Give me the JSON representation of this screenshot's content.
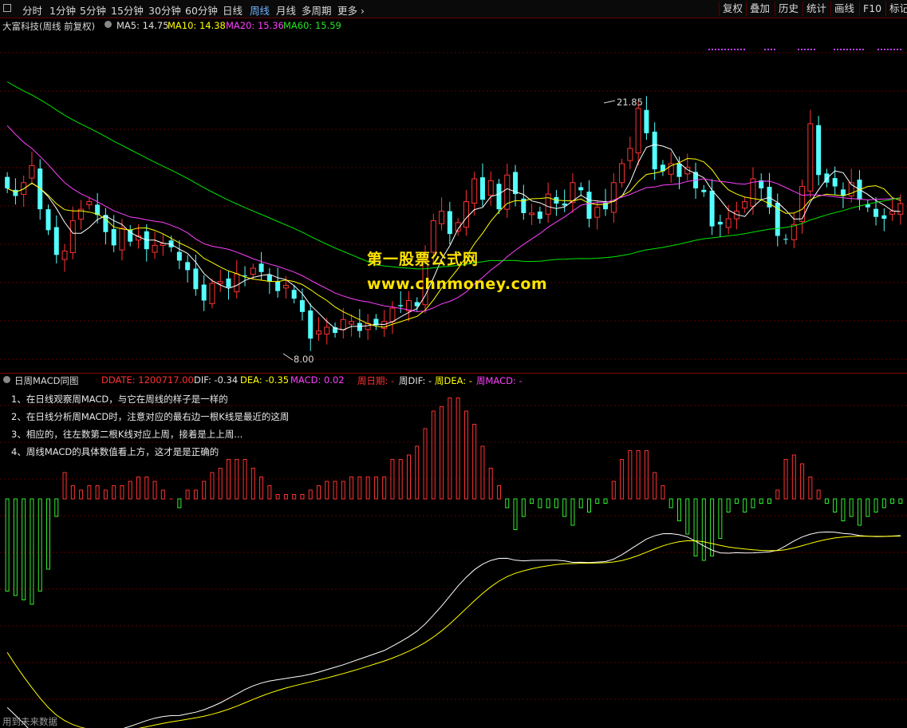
{
  "topbar": {
    "periods": [
      "分时",
      "1分钟",
      "5分钟",
      "15分钟",
      "30分钟",
      "60分钟",
      "日线",
      "周线",
      "月线",
      "多周期",
      "更多"
    ],
    "active_period": "周线",
    "right_buttons": [
      "复权",
      "叠加",
      "历史",
      "统计",
      "画线",
      "F10",
      "标记"
    ]
  },
  "main": {
    "title": "大富科技(周线 前复权)",
    "ma5": "MA5: 14.75",
    "ma10": "MA10: 14.38",
    "ma20": "MA20: 15.36",
    "ma60": "MA60: 15.59",
    "high_label": "21.85",
    "low_label": "8.00"
  },
  "watermark": {
    "line1": "第一股票公式网",
    "line2": "www.chnmoney.com"
  },
  "macd": {
    "title": "日周MACD同图",
    "ddate": "DDATE: 1200717.00",
    "dif": "DIF: -0.34",
    "dea": "DEA: -0.35",
    "macd": "MACD: 0.02",
    "week_date": "周日期: -",
    "week_dif": "周DIF: -",
    "week_dea": "周DEA: -",
    "week_macd": "周MACD: -",
    "notes": [
      "1、在日线观察周MACD，与它在周线的样子是一样的",
      "2、在日线分析周MACD时，注意对应的最右边一根K线是最近的这周",
      "3、相应的，往左数第二根K线对应上周，接着是上上周...",
      "4、周线MACD的具体数值看上方，这才是是正确的"
    ]
  },
  "footer": "用到未来数据",
  "colors": {
    "up": "#ff3232",
    "down": "#54ffff",
    "ma5": "#ffffff",
    "ma10": "#ffff00",
    "ma20": "#ff40ff",
    "ma60": "#00e600",
    "macd_pos": "#ff3232",
    "macd_neg": "#33ee33",
    "grid": "#5a0000"
  },
  "chart_data": [
    {
      "type": "candlestick",
      "series": [
        {
          "name": "MA5"
        },
        {
          "name": "MA10"
        },
        {
          "name": "MA20"
        },
        {
          "name": "MA60"
        }
      ],
      "annotations": [
        "21.85",
        "8.00"
      ],
      "close": [
        16.9,
        16.5,
        17.2,
        18.1,
        15.8,
        14.7,
        13.4,
        13.6,
        15.2,
        15.8,
        16.2,
        15.5,
        14.6,
        13.9,
        14.8,
        14.1,
        14.4,
        13.7,
        13.9,
        14.0,
        13.8,
        13.1,
        12.6,
        11.6,
        11.0,
        11.9,
        12.0,
        11.7,
        12.4,
        12.3,
        12.7,
        12.5,
        12.0,
        11.5,
        11.8,
        11.1,
        10.4,
        9.0,
        9.4,
        9.6,
        9.3,
        10.0,
        9.9,
        9.4,
        9.8,
        9.7,
        9.9,
        10.6,
        10.7,
        11.0,
        10.7,
        13.3,
        15.2,
        15.7,
        14.5,
        15.1,
        16.2,
        17.4,
        16.3,
        17.3,
        15.8,
        17.6,
        16.6,
        15.6,
        15.6,
        15.3,
        16.6,
        16.1,
        16.0,
        17.2,
        16.8,
        15.3,
        15.9,
        15.8,
        17.2,
        18.2,
        19.0,
        21.1,
        19.8,
        17.9,
        17.8,
        18.2,
        17.5,
        18.0,
        16.9,
        16.7,
        14.9,
        15.0,
        15.3,
        15.7,
        16.2,
        17.4,
        16.9,
        15.9,
        14.4,
        14.2,
        15.0,
        17.0,
        20.3,
        17.6,
        17.2,
        17.0,
        16.5,
        17.2,
        16.3,
        15.9,
        15.4,
        15.3,
        15.7,
        16.1
      ]
    },
    {
      "type": "bar",
      "series": [
        {
          "name": "MACD",
          "values": [
            -2.1,
            -2.2,
            -2.3,
            -2.4,
            -2.1,
            -1.6,
            -0.4,
            0.6,
            0.3,
            0.2,
            0.3,
            0.3,
            0.2,
            0.3,
            0.3,
            0.4,
            0.5,
            0.5,
            0.4,
            0.2,
            0.0,
            -0.2,
            0.2,
            0.2,
            0.4,
            0.6,
            0.7,
            0.9,
            0.9,
            0.9,
            0.7,
            0.5,
            0.3,
            0.1,
            0.1,
            0.1,
            0.1,
            0.2,
            0.3,
            0.4,
            0.4,
            0.4,
            0.5,
            0.5,
            0.5,
            0.5,
            0.5,
            0.9,
            0.9,
            1.0,
            1.2,
            1.6,
            2.0,
            2.1,
            2.3,
            2.3,
            2.0,
            1.7,
            1.2,
            0.7,
            0.3,
            -0.2,
            -0.7,
            -0.4,
            -0.1,
            -0.2,
            -0.2,
            -0.2,
            -0.4,
            -0.6,
            -0.2,
            -0.3,
            -0.1,
            -0.1,
            0.4,
            0.9,
            1.1,
            1.1,
            1.1,
            0.6,
            0.3,
            -0.2,
            -0.5,
            -0.8,
            -1.3,
            -1.4,
            -1.3,
            -0.9,
            -0.3,
            -0.1,
            -0.3,
            -0.2,
            -0.1,
            -0.1,
            0.2,
            0.9,
            1.0,
            0.8,
            0.5,
            0.2,
            -0.1,
            -0.3,
            -0.5,
            -0.4,
            -0.6,
            -0.4,
            -0.3,
            -0.2,
            -0.1,
            -0.1
          ]
        }
      ]
    }
  ]
}
